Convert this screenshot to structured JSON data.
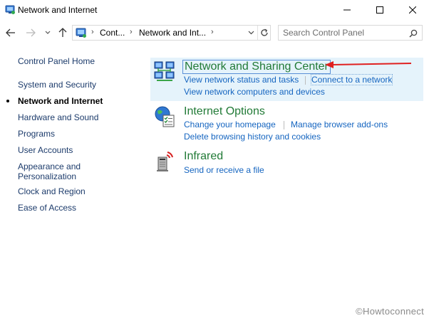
{
  "window": {
    "title": "Network and Internet"
  },
  "address_bar": {
    "crumbs": [
      "Cont...",
      "Network and Int..."
    ]
  },
  "search": {
    "placeholder": "Search Control Panel"
  },
  "sidebar": {
    "items": [
      {
        "label": "Control Panel Home"
      },
      {
        "label": "System and Security"
      },
      {
        "label": "Network and Internet",
        "active": true
      },
      {
        "label": "Hardware and Sound"
      },
      {
        "label": "Programs"
      },
      {
        "label": "User Accounts"
      },
      {
        "label": "Appearance and\nPersonalization"
      },
      {
        "label": "Clock and Region"
      },
      {
        "label": "Ease of Access"
      }
    ]
  },
  "categories": [
    {
      "title": "Network and Sharing Center",
      "icon": "network-sharing-icon",
      "tasks": [
        "View network status and tasks",
        "Connect to a network",
        "View network computers and devices"
      ]
    },
    {
      "title": "Internet Options",
      "icon": "internet-options-icon",
      "tasks": [
        "Change your homepage",
        "Manage browser add-ons",
        "Delete browsing history and cookies"
      ]
    },
    {
      "title": "Infrared",
      "icon": "infrared-icon",
      "tasks": [
        "Send or receive a file"
      ]
    }
  ],
  "watermark": "©Howtoconnect",
  "colors": {
    "category_title": "#217a36",
    "task_link": "#1565c0",
    "sidebar_link": "#1c3b6b",
    "highlight": "#e5f3fb",
    "annotation_arrow": "#e02020"
  }
}
